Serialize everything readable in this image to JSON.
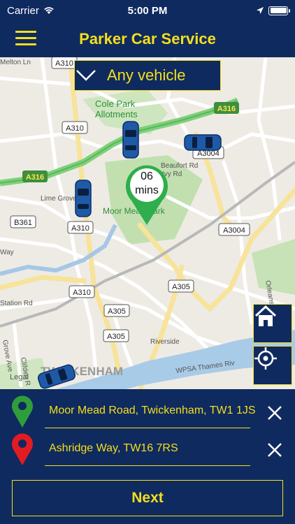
{
  "status_bar": {
    "carrier": "Carrier",
    "time": "5:00 PM"
  },
  "nav": {
    "title": "Parker Car Service"
  },
  "vehicle_filter": {
    "selected": "Any vehicle"
  },
  "map": {
    "eta": {
      "value": "06",
      "unit": "mins"
    },
    "labels": {
      "place1": "Cole Park",
      "place2": "Allotments",
      "place3": "Moor Mead Park",
      "place4": "TWICKENHAM",
      "street1": "Station Rd",
      "street2": "Riverside",
      "street3": "WPSA Thames Riv",
      "street4": "Lime Grove",
      "street5": "Clifden R",
      "street6": "Grove Ave",
      "street7": "Orleans",
      "street8": "Legal",
      "street9": "Beaufort Rd",
      "street10": "Ivy Rd",
      "street11": "Way",
      "street12": "Melton Ln"
    },
    "road_badges": [
      "A310",
      "A316",
      "A310",
      "A3004",
      "A316",
      "B361",
      "A310",
      "A3004",
      "A310",
      "A305",
      "A305",
      "A305"
    ]
  },
  "pickup": {
    "address": "Moor Mead Road, Twickenham, TW1 1JS",
    "pin_color": "#2e9e3a"
  },
  "dropoff": {
    "address": "Ashridge Way, TW16 7RS",
    "pin_color": "#e31b23"
  },
  "actions": {
    "next_label": "Next"
  },
  "colors": {
    "brand": "#0f2a5f",
    "accent": "#f5df1b",
    "car": "#1f5aa6"
  }
}
